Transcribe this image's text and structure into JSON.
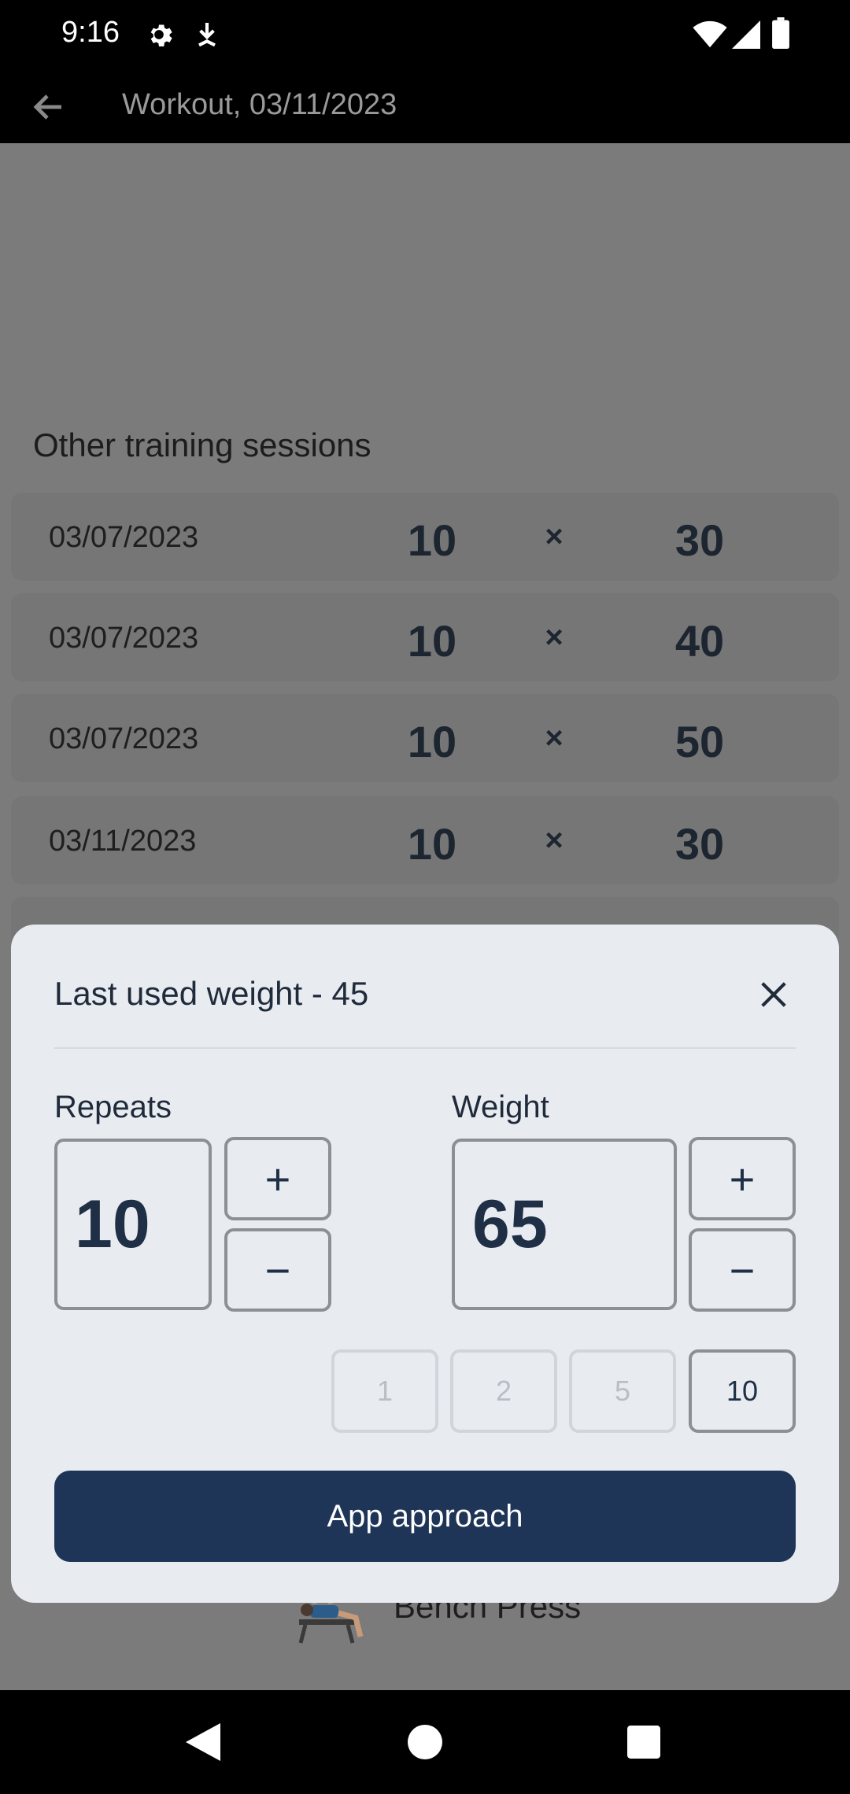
{
  "status_bar": {
    "time": "9:16",
    "icons": [
      "settings-icon",
      "download-icon",
      "wifi-icon",
      "signal-icon",
      "battery-icon"
    ]
  },
  "app_bar": {
    "title": "Workout, 03/11/2023",
    "back_icon": "back-arrow-icon"
  },
  "content": {
    "section_title": "Other training sessions",
    "sessions": [
      {
        "date": "03/07/2023",
        "reps": "10",
        "x": "×",
        "weight": "30"
      },
      {
        "date": "03/07/2023",
        "reps": "10",
        "x": "×",
        "weight": "40"
      },
      {
        "date": "03/07/2023",
        "reps": "10",
        "x": "×",
        "weight": "50"
      },
      {
        "date": "03/11/2023",
        "reps": "10",
        "x": "×",
        "weight": "30"
      }
    ],
    "exercise": {
      "label": "Bench Press"
    }
  },
  "dialog": {
    "title": "Last used weight - 45",
    "repeats_label": "Repeats",
    "repeats_value": "10",
    "weight_label": "Weight",
    "weight_value": "65",
    "plus": "+",
    "minus": "−",
    "increments": [
      "1",
      "2",
      "5",
      "10"
    ],
    "selected_increment": "10",
    "primary_button": "App approach"
  },
  "colors": {
    "accent": "#1f3557",
    "dialog_bg": "#e8ebf0",
    "scrim": "#7b7b7b"
  }
}
